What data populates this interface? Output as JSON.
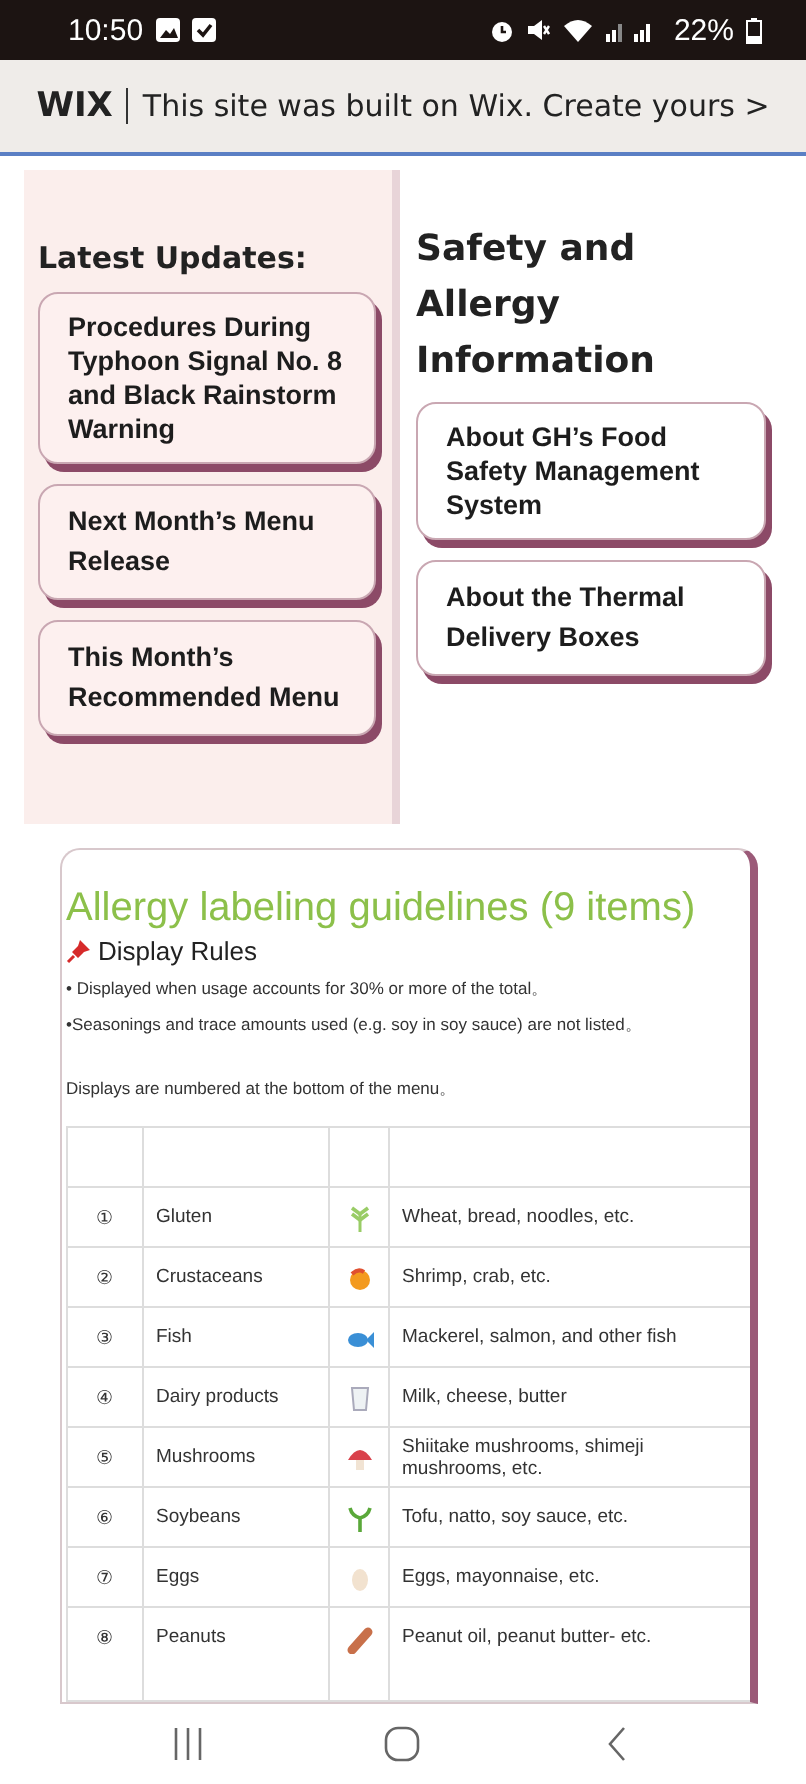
{
  "status_bar": {
    "time": "10:50",
    "battery": "22%"
  },
  "banner": {
    "logo": "WIX",
    "text": "This site was built on Wix. Create yours >"
  },
  "latest_updates": {
    "title": "Latest Updates:",
    "items": [
      {
        "label": "Procedures During Typhoon Signal No. 8 and Black Rainstorm Warning"
      },
      {
        "label": "Next Month’s Menu Release"
      },
      {
        "label": "This Month’s Recommended Menu"
      }
    ]
  },
  "safety": {
    "title": "Safety and Allergy Information",
    "items": [
      {
        "label": "About GH’s Food Safety Management System"
      },
      {
        "label": "About the Thermal Delivery Boxes"
      }
    ]
  },
  "allergy": {
    "title": "Allergy labeling guidelines (9 items)",
    "subtitle": "Display Rules",
    "rules": [
      "• Displayed when usage accounts for 30% or more of the total。",
      "•Seasonings and trace amounts used (e.g. soy in soy sauce) are not listed。"
    ],
    "note": "Displays are numbered at the bottom of the menu。",
    "rows": [
      {
        "number": "①",
        "name": "Gluten",
        "examples": "Wheat, bread, noodles, etc."
      },
      {
        "number": "②",
        "name": "Crustaceans",
        "examples": "Shrimp, crab, etc."
      },
      {
        "number": "③",
        "name": "Fish",
        "examples": "Mackerel, salmon, and other fish"
      },
      {
        "number": "④",
        "name": "Dairy products",
        "examples": "Milk, cheese, butter"
      },
      {
        "number": "⑤",
        "name": "Mushrooms",
        "examples": "Shiitake mushrooms, shimeji mushrooms, etc."
      },
      {
        "number": "⑥",
        "name": "Soybeans",
        "examples": "Tofu, natto, soy sauce, etc."
      },
      {
        "number": "⑦",
        "name": "Eggs",
        "examples": "Eggs, mayonnaise, etc."
      },
      {
        "number": "⑧",
        "name": "Peanuts",
        "examples": "Peanut oil, peanut butter- etc."
      }
    ]
  }
}
